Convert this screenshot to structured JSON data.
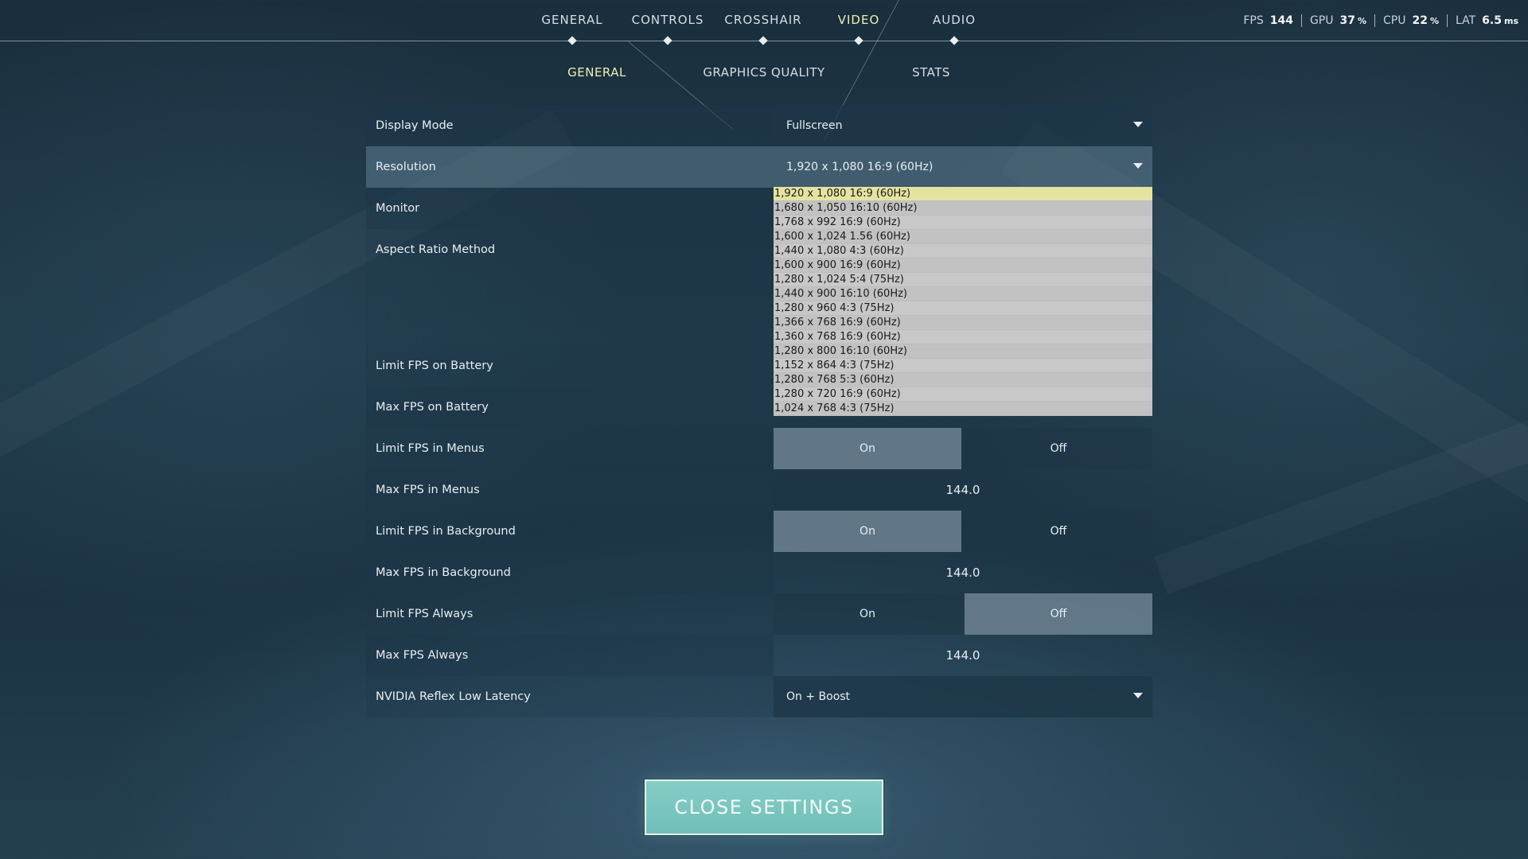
{
  "nav": {
    "tabs": [
      {
        "label": "GENERAL"
      },
      {
        "label": "CONTROLS"
      },
      {
        "label": "CROSSHAIR"
      },
      {
        "label": "VIDEO"
      },
      {
        "label": "AUDIO"
      }
    ],
    "active": "VIDEO"
  },
  "stats": {
    "fps": {
      "label": "FPS",
      "value": "144"
    },
    "gpu": {
      "label": "GPU",
      "value": "37",
      "unit": "%"
    },
    "cpu": {
      "label": "CPU",
      "value": "22",
      "unit": "%"
    },
    "lat": {
      "label": "LAT",
      "value": "6.5",
      "unit": "ms"
    }
  },
  "subtabs": [
    {
      "label": "GENERAL"
    },
    {
      "label": "GRAPHICS QUALITY"
    },
    {
      "label": "STATS"
    }
  ],
  "settings": {
    "display_mode": {
      "label": "Display Mode",
      "value": "Fullscreen"
    },
    "resolution": {
      "label": "Resolution",
      "value": "1,920 x 1,080 16:9 (60Hz)"
    },
    "monitor": {
      "label": "Monitor"
    },
    "aspect_ratio": {
      "label": "Aspect Ratio Method"
    },
    "limit_fps_battery": {
      "label": "Limit FPS on Battery"
    },
    "max_fps_battery": {
      "label": "Max FPS on Battery"
    },
    "limit_fps_menus": {
      "label": "Limit FPS in Menus",
      "on": "On",
      "off": "Off"
    },
    "max_fps_menus": {
      "label": "Max FPS in Menus",
      "value": "144.0"
    },
    "limit_fps_background": {
      "label": "Limit FPS in Background",
      "on": "On",
      "off": "Off"
    },
    "max_fps_background": {
      "label": "Max FPS in Background",
      "value": "144.0"
    },
    "limit_fps_always": {
      "label": "Limit FPS Always",
      "on": "On",
      "off": "Off"
    },
    "max_fps_always": {
      "label": "Max FPS Always",
      "value": "144.0"
    },
    "nvidia_reflex": {
      "label": "NVIDIA Reflex Low Latency",
      "value": "On + Boost"
    }
  },
  "resolution_options": [
    "1,920 x 1,080 16:9 (60Hz)",
    "1,680 x 1,050 16:10 (60Hz)",
    "1,768 x 992 16:9 (60Hz)",
    "1,600 x 1,024 1.56 (60Hz)",
    "1,440 x 1,080 4:3 (60Hz)",
    "1,600 x 900 16:9 (60Hz)",
    "1,280 x 1,024 5:4 (75Hz)",
    "1,440 x 900 16:10 (60Hz)",
    "1,280 x 960 4:3 (75Hz)",
    "1,366 x 768 16:9 (60Hz)",
    "1,360 x 768 16:9 (60Hz)",
    "1,280 x 800 16:10 (60Hz)",
    "1,152 x 864 4:3 (75Hz)",
    "1,280 x 768 5:3 (60Hz)",
    "1,280 x 720 16:9 (60Hz)",
    "1,024 x 768 4:3 (75Hz)"
  ],
  "close_button": {
    "label": "CLOSE SETTINGS"
  },
  "colors": {
    "active_tab": "#edf0b0",
    "selected_option": "#e4e4a0",
    "close_button": "#78c6be"
  }
}
